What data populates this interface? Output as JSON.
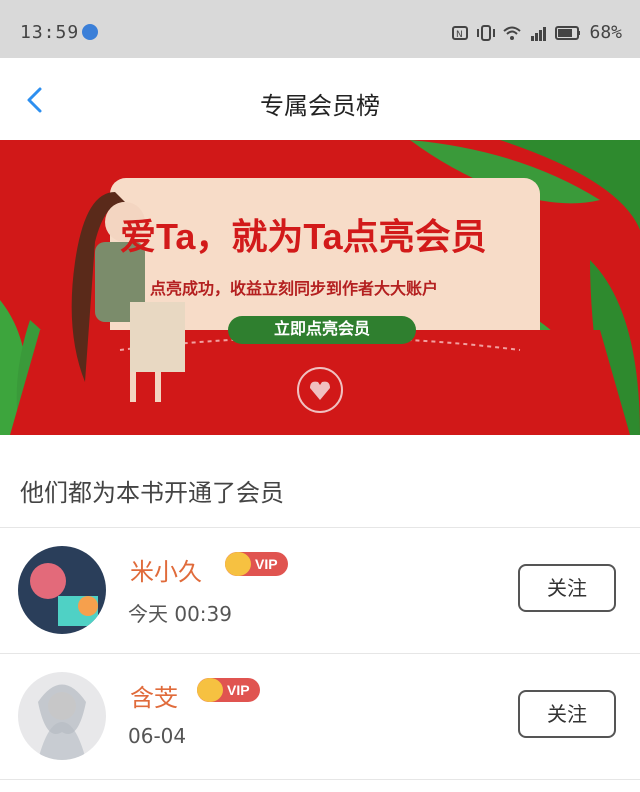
{
  "status_bar": {
    "time": "13:59",
    "battery": "68%",
    "icons": [
      "nfc-icon",
      "vibrate-icon",
      "wifi-icon",
      "4g-icon",
      "signal-icon",
      "battery-icon"
    ]
  },
  "nav": {
    "back_icon": "chevron-left-icon",
    "title": "专属会员榜"
  },
  "banner": {
    "headline": "爱Ta，就为Ta点亮会员",
    "subtitle": "点亮成功，收益立刻同步到作者大大账户",
    "cta": "立即点亮会员",
    "colors": {
      "background": "#d11818",
      "card": "#f7dcc8",
      "button": "#2f7f2f"
    }
  },
  "section": {
    "heading": "他们都为本书开通了会员",
    "members": [
      {
        "name": "米小久",
        "badge": "VIP",
        "time": "今天 00:39",
        "follow": "关注"
      },
      {
        "name": "含芠",
        "badge": "VIP",
        "time": "06-04",
        "follow": "关注"
      }
    ]
  }
}
